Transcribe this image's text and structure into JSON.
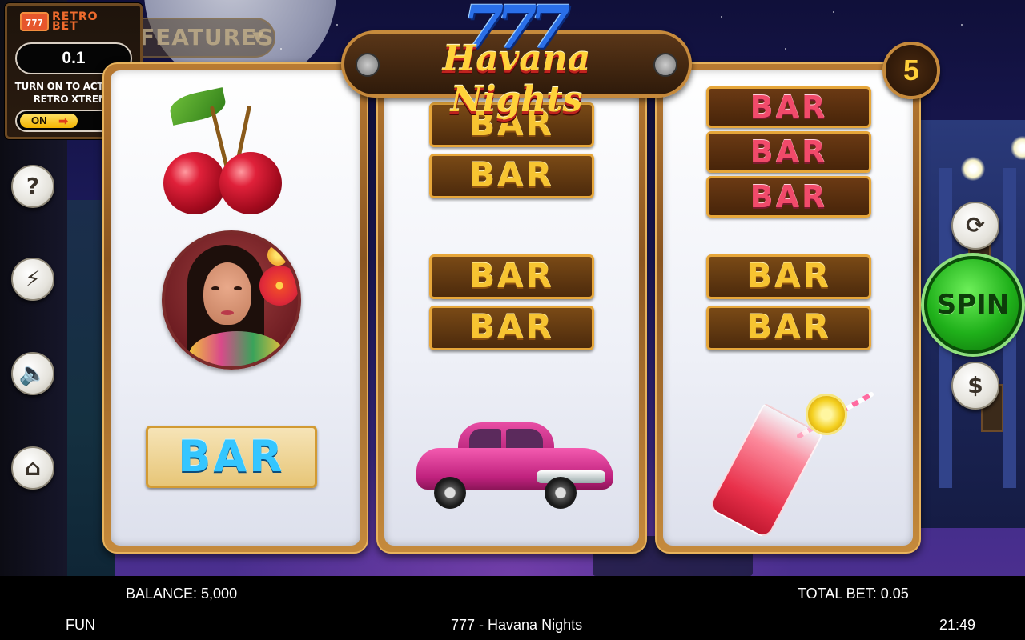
{
  "game": {
    "brand_badge": "777",
    "brand_name_line1": "RETRO",
    "brand_name_line2": "BET",
    "title_sevens": "777",
    "title": "Havana Nights",
    "paylines": "5"
  },
  "retro_panel": {
    "bet_value": "0.1",
    "note": "TURN ON TO ACTIVATE RETRO XTREME",
    "toggle_label": "ON"
  },
  "features_button": {
    "label": "FEATURES"
  },
  "left_toolbar": {
    "help_icon": "?",
    "turbo_icon": "lightning-icon",
    "sound_icon": "speaker-icon",
    "home_icon": "home-icon"
  },
  "reels": [
    {
      "symbols": [
        "cherry",
        "lady-portrait",
        "BAR"
      ]
    },
    {
      "symbols": [
        "BAR",
        "BAR",
        "BAR",
        "BAR",
        "car"
      ]
    },
    {
      "symbols": [
        "BAR",
        "BAR",
        "BAR",
        "BAR",
        "BAR",
        "cocktail"
      ]
    }
  ],
  "bar_text": "BAR",
  "right_controls": {
    "autoplay_icon": "refresh-icon",
    "spin_label": "SPIN",
    "bet_icon": "dollar-coin-icon"
  },
  "footer": {
    "balance": "BALANCE: 5,000",
    "total_bet": "TOTAL BET: 0.05",
    "mode": "FUN",
    "game_name": "777 - Havana Nights",
    "clock": "21:49"
  },
  "colors": {
    "spin_green": "#1fb01a",
    "reel_frame": "#c58a3c",
    "bar_gold": "#f7c431",
    "bar_pink": "#f14a6a",
    "bar_cyan": "#35c6ff"
  }
}
